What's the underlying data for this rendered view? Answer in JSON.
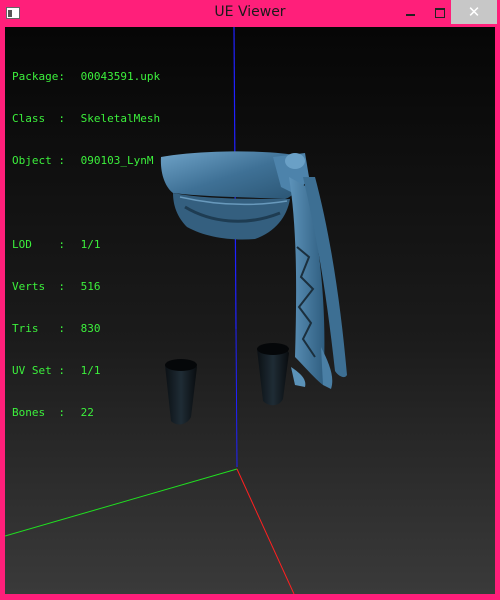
{
  "window": {
    "title": "UE Viewer",
    "close_glyph": "✕"
  },
  "info": {
    "package_label": "Package:",
    "package_value": "00043591.upk",
    "class_label": "Class  :",
    "class_value": "SkeletalMesh",
    "object_label": "Object :",
    "object_value": "090103_LynM",
    "lod_label": "LOD    :",
    "lod_value": "1/1",
    "verts_label": "Verts  :",
    "verts_value": "516",
    "tris_label": "Tris   :",
    "tris_value": "830",
    "uvset_label": "UV Set :",
    "uvset_value": "1/1",
    "bones_label": "Bones  :",
    "bones_value": "22"
  },
  "colors": {
    "frame": "#ff1f7a",
    "info_text": "#3cf03c",
    "axis_x": "#ff2020",
    "axis_y": "#20e020",
    "axis_z": "#2020ff",
    "mesh_blue": "#4f86b0",
    "mesh_dark": "#10161b"
  }
}
